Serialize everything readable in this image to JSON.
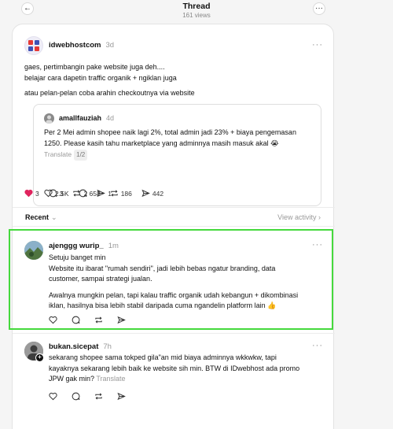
{
  "header": {
    "title": "Thread",
    "views": "161 views",
    "back_icon": "arrow-left-icon",
    "more_icon": "ellipsis-icon"
  },
  "main_post": {
    "username": "idwebhostcom",
    "time": "3d",
    "more": "···",
    "lines": [
      "gaes, pertimbangin pake website juga deh....",
      "belajar cara dapetin traffic organik + ngiklan juga"
    ],
    "line3": "atau pelan-pelan coba arahin checkoutnya via website",
    "quote": {
      "username": "amallfauziah",
      "time": "4d",
      "text1": "Per 2 Mei admin shopee naik lagi 2%, total admin jadi 23% + biaya pengemasan",
      "text2": "1250. Please kasih tahu marketplace yang adminnya masih masuk akal 😭",
      "translate": "Translate",
      "page": "1/2",
      "likes": "2.5K",
      "comments": "658",
      "reposts": "186",
      "shares": "442"
    },
    "likes": "3",
    "comments": "3",
    "reposts": "2",
    "shares": "1",
    "like_color": "#e0245e"
  },
  "filter": {
    "recent": "Recent",
    "chevron": "⌄",
    "view_activity": "View activity",
    "arrow": "›"
  },
  "replies": [
    {
      "username": "ajenggg wurip_",
      "time": "1m",
      "more": "···",
      "l1": "Setuju banget min",
      "l2": "Website itu ibarat \"rumah sendiri\", jadi lebih bebas ngatur branding, data",
      "l3": "customer, sampai strategi jualan.",
      "l4": "Awalnya mungkin pelan, tapi kalau traffic organik udah kebangun + dikombinasi",
      "l5": "iklan, hasilnya bisa lebih stabil daripada cuma ngandelin platform lain 👍"
    },
    {
      "username": "bukan.sicepat",
      "time": "7h",
      "more": "···",
      "l1": "sekarang shopee sama tokped gila\"an mid biaya adminnya wkkwkw, tapi",
      "l2": "kayaknya sekarang lebih baik ke website sih min. BTW di IDwebhost ada promo",
      "l3": "JPW gak min?",
      "translate": "Translate"
    }
  ],
  "colors": {
    "highlight": "#45d93c",
    "muted": "#999999"
  }
}
